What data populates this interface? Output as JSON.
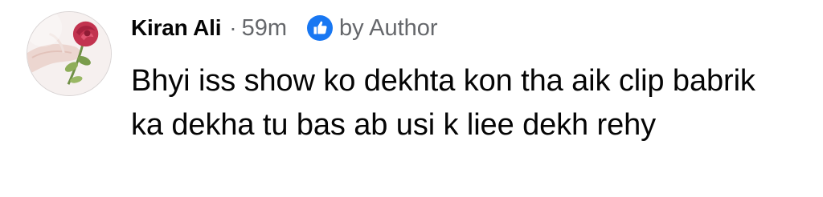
{
  "comment": {
    "author": "Kiran Ali",
    "separator": "·",
    "time": "59m",
    "badge_icon": "thumbs-up-icon",
    "badge_label": "by Author",
    "text": "Bhyi iss show ko dekhta kon tha aik clip babrik ka dekha tu bas ab usi k liee dekh rehy"
  },
  "colors": {
    "name_text": "#050505",
    "meta_text": "#65676b",
    "badge_blue": "#1877f2"
  }
}
